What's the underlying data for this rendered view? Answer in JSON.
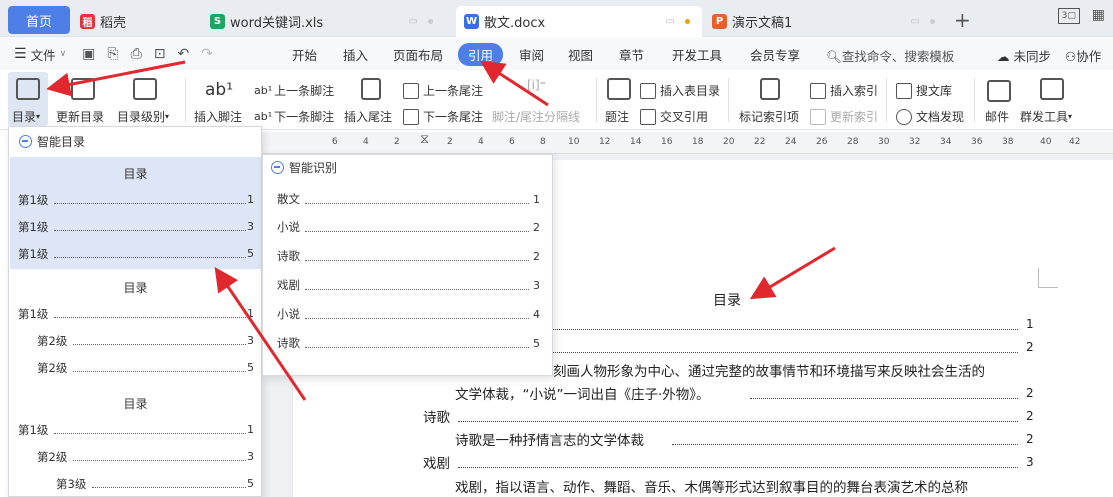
{
  "tabs": {
    "home": "首页",
    "t1": "稻壳",
    "t2": "word关键词.xls",
    "t3": "散文.docx",
    "t4": "演示文稿1"
  },
  "menubar": {
    "file": "文件",
    "tabs": [
      "开始",
      "插入",
      "页面布局",
      "引用",
      "审阅",
      "视图",
      "章节",
      "开发工具",
      "会员专享"
    ],
    "active": "引用",
    "search": "查找命令、搜索模板",
    "sync": "未同步",
    "collab": "协作"
  },
  "ribbon": {
    "toc": "目录",
    "update_toc": "更新目录",
    "toc_level": "目录级别",
    "insert_footnote": "插入脚注",
    "prev_footnote": "上一条脚注",
    "next_footnote": "下一条脚注",
    "insert_endnote": "插入尾注",
    "prev_endnote": "上一条尾注",
    "next_endnote": "下一条尾注",
    "separator": "脚注/尾注分隔线",
    "caption": "题注",
    "insert_table_toc": "插入表目录",
    "cross_ref": "交叉引用",
    "mark_index": "标记索引项",
    "insert_index": "插入索引",
    "update_index": "更新索引",
    "search_lib": "搜文库",
    "doc_discover": "文档发现",
    "mail": "邮件",
    "mass_tool": "群发工具"
  },
  "ruler": {
    "marks": [
      "6",
      "4",
      "2",
      "2",
      "4",
      "6",
      "8",
      "10",
      "12",
      "14",
      "16",
      "18",
      "20",
      "22",
      "24",
      "26",
      "28",
      "30",
      "32",
      "34",
      "36",
      "38",
      "40",
      "42"
    ]
  },
  "toc_dropdown": {
    "smart_toc": "智能目录",
    "styles": [
      {
        "title": "目录",
        "items": [
          {
            "label": "第1级",
            "page": "1"
          },
          {
            "label": "第1级",
            "page": "3"
          },
          {
            "label": "第1级",
            "page": "5"
          }
        ]
      },
      {
        "title": "目录",
        "items": [
          {
            "label": "第1级",
            "page": "1"
          },
          {
            "label": "第2级",
            "page": "3"
          },
          {
            "label": "第2级",
            "page": "5"
          }
        ]
      },
      {
        "title": "目录",
        "items": [
          {
            "label": "第1级",
            "page": "1"
          },
          {
            "label": "第2级",
            "page": "3"
          },
          {
            "label": "第3级",
            "page": "5"
          }
        ]
      }
    ]
  },
  "smart_recognize": {
    "title": "智能识别",
    "items": [
      {
        "label": "散文",
        "page": "1"
      },
      {
        "label": "小说",
        "page": "2"
      },
      {
        "label": "诗歌",
        "page": "2"
      },
      {
        "label": "戏剧",
        "page": "3"
      },
      {
        "label": "小说",
        "page": "4"
      },
      {
        "label": "诗歌",
        "page": "5"
      }
    ]
  },
  "document": {
    "title": "目录",
    "entry_novel_frag": "刻画人物形象为中心、通过完整的故事情节和环境描写来反映社会生活的",
    "entry_novel_2": "文学体裁，“小说”一词出自《庄子·外物》。",
    "entry_poetry": "诗歌",
    "entry_poetry_desc": "诗歌是一种抒情言志的文学体裁",
    "entry_drama": "戏剧",
    "entry_drama_desc": "戏剧，指以语言、动作、舞蹈、音乐、木偶等形式达到叙事目的的舞台表演艺术的总称",
    "pages": [
      "1",
      "2",
      "2",
      "2",
      "2",
      "3"
    ]
  }
}
